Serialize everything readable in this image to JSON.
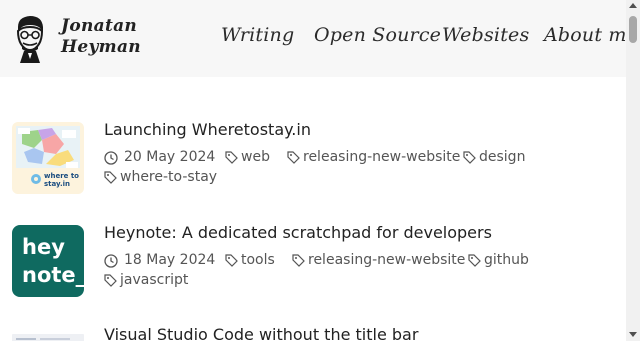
{
  "site": {
    "name_line1": "Jonatan",
    "name_line2": "Heyman"
  },
  "nav": {
    "writing": "Writing",
    "open_source": "Open Source",
    "websites": "Websites",
    "about": "About me"
  },
  "posts": [
    {
      "title": "Launching Wheretostay.in",
      "date": "20 May 2024",
      "tags": [
        "web",
        "releasing-new-website",
        "design",
        "where-to-stay"
      ],
      "thumb_text_1": "where to",
      "thumb_text_2": "stay.in"
    },
    {
      "title": "Heynote: A dedicated scratchpad for developers",
      "date": "18 May 2024",
      "tags": [
        "tools",
        "releasing-new-website",
        "github",
        "javascript"
      ],
      "thumb_text_1": "hey",
      "thumb_text_2": "note_"
    },
    {
      "title": "Visual Studio Code without the title bar"
    }
  ],
  "icons": {
    "date": "clock-icon",
    "tag": "tag-icon"
  }
}
